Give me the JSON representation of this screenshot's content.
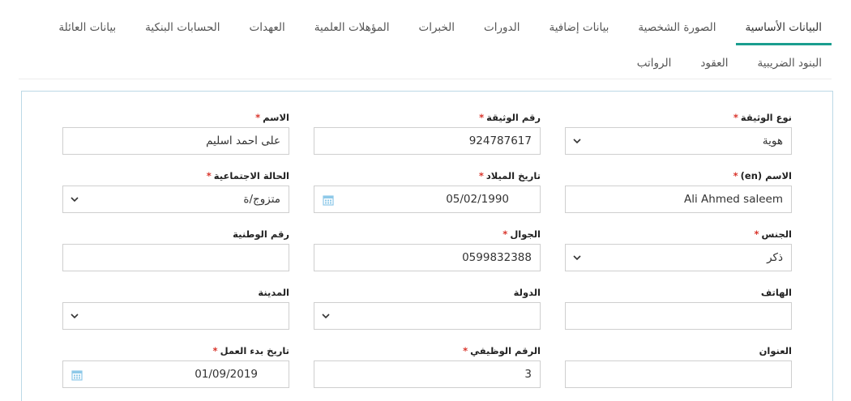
{
  "tabs": {
    "row1": [
      "البيانات الأساسية",
      "الصورة الشخصية",
      "بيانات إضافية",
      "الدورات",
      "الخبرات",
      "المؤهلات العلمية",
      "العهدات",
      "الحسابات البنكية",
      "بيانات العائلة"
    ],
    "row2": [
      "البنود الضريبية",
      "العقود",
      "الرواتب"
    ],
    "active": "البيانات الأساسية"
  },
  "form": {
    "doc_type": {
      "label": "نوع الوثيقة",
      "value": "هوية"
    },
    "doc_number": {
      "label": "رقم الوثيقة",
      "value": "924787617"
    },
    "name_ar": {
      "label": "الاسم",
      "value": "على احمد اسليم"
    },
    "name_en": {
      "label": "الاسم (en)",
      "value": "Ali Ahmed saleem"
    },
    "birth_date": {
      "label": "تاريخ الميلاد",
      "value": "05/02/1990"
    },
    "marital_status": {
      "label": "الحالة الاجتماعية",
      "value": "متزوج/ة"
    },
    "gender": {
      "label": "الجنس",
      "value": "ذكر"
    },
    "mobile": {
      "label": "الجوال",
      "value": "0599832388"
    },
    "national_id": {
      "label": "رقم الوطنية",
      "value": ""
    },
    "phone": {
      "label": "الهاتف",
      "value": ""
    },
    "country": {
      "label": "الدولة",
      "value": ""
    },
    "city": {
      "label": "المدينة",
      "value": ""
    },
    "address": {
      "label": "العنوان",
      "value": ""
    },
    "employee_number": {
      "label": "الرقم الوظيفي",
      "value": "3"
    },
    "work_start_date": {
      "label": "تاريخ بدء العمل",
      "value": "01/09/2019"
    }
  },
  "required_marker": "*",
  "colors": {
    "accent": "#1a9e8f",
    "required": "#d9342b",
    "panel_border": "#bcd9e6",
    "calendar_icon": "#8ec9e8"
  }
}
